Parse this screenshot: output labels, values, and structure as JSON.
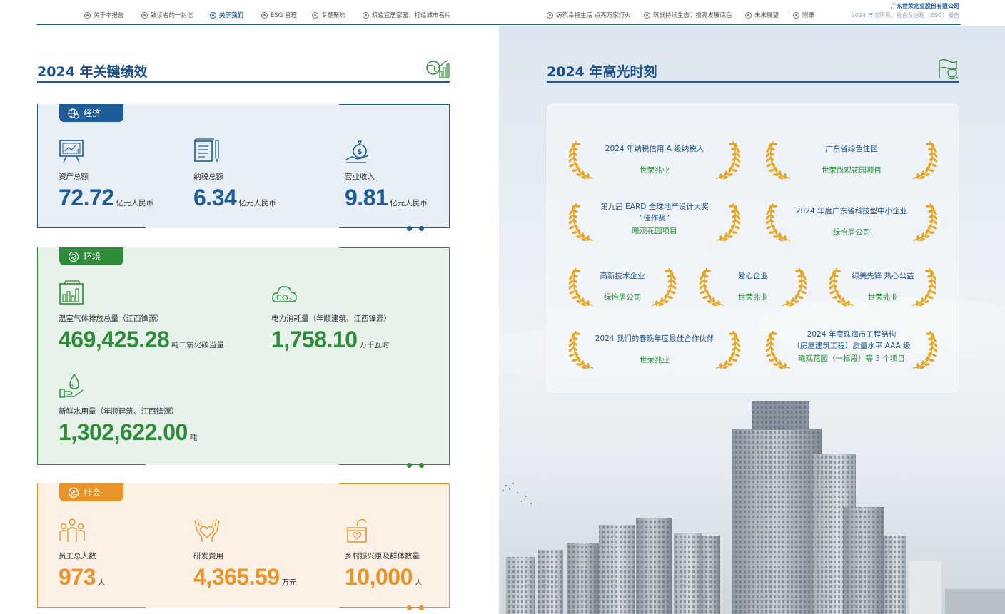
{
  "nav": {
    "items": [
      {
        "label": "关于本报告",
        "active": false
      },
      {
        "label": "致读者的一封信",
        "active": false
      },
      {
        "label": "关于我们",
        "active": true
      },
      {
        "label": "ESG 管理",
        "active": false
      },
      {
        "label": "专题聚焦",
        "active": false
      },
      {
        "label": "筑造宜居家园，打造城市名片",
        "active": false
      },
      {
        "label": "铸筑幸福生活 点亮万家灯火",
        "active": false
      },
      {
        "label": "筑就持续生态，擦亮发展底色",
        "active": false
      },
      {
        "label": "未来展望",
        "active": false
      },
      {
        "label": "附录",
        "active": false
      }
    ],
    "company": "广东世荣兆业股份有限公司",
    "report_name": "2024 年度环境、社会及治理（ESG）报告"
  },
  "left": {
    "title": "2024 年关键绩效",
    "title_icon": "growth-chart-icon",
    "economy": {
      "tag": "经济",
      "tag_icon": "globe-money-icon",
      "color": "#1d5c98",
      "metrics": [
        {
          "icon": "easel-chart-icon",
          "label": "资产总额",
          "value": "72.72",
          "unit": "亿元人民币"
        },
        {
          "icon": "document-pen-icon",
          "label": "纳税总额",
          "value": "6.34",
          "unit": "亿元人民币"
        },
        {
          "icon": "money-bag-hand-icon",
          "label": "营业收入",
          "value": "9.81",
          "unit": "亿元人民币"
        }
      ]
    },
    "environment": {
      "tag": "环境",
      "tag_icon": "leaf-globe-icon",
      "color": "#2e8b3a",
      "metrics": [
        {
          "icon": "bar-chart-board-icon",
          "label": "温室气体排放总量（江西锋源）",
          "value": "469,425.28",
          "unit": "吨二氧化碳当量"
        },
        {
          "icon": "co2-cloud-icon",
          "label": "电力消耗量（年顺建筑、江西锋源）",
          "value": "1,758.10",
          "unit": "万千瓦时"
        },
        {
          "icon": "water-drop-hand-icon",
          "label": "新鲜水用量（年顺建筑、江西锋源）",
          "value": "1,302,622.00",
          "unit": "吨"
        }
      ]
    },
    "society": {
      "tag": "社会",
      "tag_icon": "people-globe-icon",
      "color": "#e8942a",
      "metrics": [
        {
          "icon": "people-group-icon",
          "label": "员工总人数",
          "value": "973",
          "unit": "人"
        },
        {
          "icon": "heart-hands-icon",
          "label": "研发费用",
          "value": "4,365.59",
          "unit": "万元"
        },
        {
          "icon": "charity-box-icon",
          "label": "乡村振兴惠及群体数量",
          "value": "10,000",
          "unit": "人"
        }
      ]
    }
  },
  "right": {
    "title": "2024 年高光时刻",
    "title_icon": "trophy-flag-icon",
    "awards": [
      {
        "title": "2024 年纳税信用 A 级纳税人",
        "org": "世荣兆业"
      },
      {
        "title": "广东省绿色住区",
        "org": "世荣尚观花园项目"
      },
      {
        "title": "第九届 EARD 全球地产设计大奖\n“佳作奖”",
        "org": "曦观花园项目"
      },
      {
        "title": "2024 年度广东省科技型中小企业",
        "org": "绿怡居公司"
      },
      {
        "title": "高新技术企业",
        "org": "绿怡居公司"
      },
      {
        "title": "爱心企业",
        "org": "世荣兆业"
      },
      {
        "title": "绿美先锋 热心公益",
        "org": "世荣兆业"
      },
      {
        "title": "2024 我们的春晚年度最佳合作伙伴",
        "org": "世荣兆业"
      },
      {
        "title": "2024 年度珠海市工程结构\n（房屋建筑工程）质量水平 AAA 级",
        "org": "曦观花园（一标段）等 3 个项目"
      }
    ],
    "photo": "high-rise-residential-buildings-photo"
  },
  "colors": {
    "primary_blue": "#1d5c98",
    "env_green": "#2e8b3a",
    "soc_orange": "#e8942a",
    "laurel_gold": "#e6a623"
  }
}
